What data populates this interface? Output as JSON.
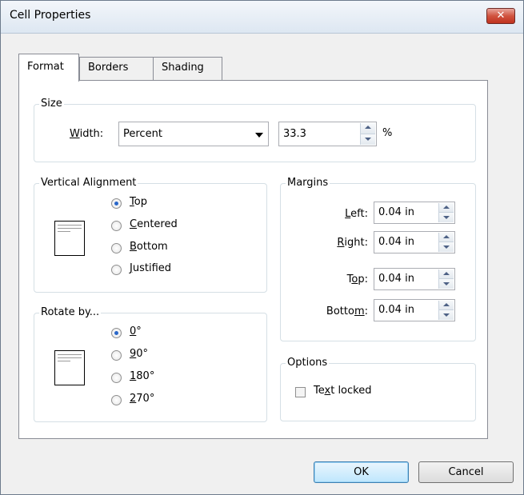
{
  "window": {
    "title": "Cell Properties",
    "close_glyph": "✕"
  },
  "tabs": [
    "Format",
    "Borders",
    "Shading"
  ],
  "size": {
    "legend": "Size",
    "width_label_prefix": "",
    "width_label_u": "W",
    "width_label_rest": "idth:",
    "type_value": "Percent",
    "amount_value": "33.3",
    "unit": "%"
  },
  "vertical_alignment": {
    "legend": "Vertical Alignment",
    "options": [
      {
        "u": "T",
        "rest": "op",
        "selected": true
      },
      {
        "u": "C",
        "rest": "entered",
        "selected": false
      },
      {
        "u": "B",
        "rest": "ottom",
        "selected": false
      },
      {
        "u": "J",
        "rest": "ustified",
        "selected": false
      }
    ]
  },
  "rotate": {
    "legend": "Rotate by...",
    "options": [
      {
        "u": "0",
        "rest": "°",
        "selected": true
      },
      {
        "u": "9",
        "rest": "0°",
        "selected": false
      },
      {
        "u": "1",
        "rest": "80°",
        "selected": false
      },
      {
        "u": "2",
        "rest": "70°",
        "selected": false
      }
    ]
  },
  "margins": {
    "legend": "Margins",
    "fields": [
      {
        "pre": "",
        "u": "L",
        "post": "eft:",
        "value": "0.04 in"
      },
      {
        "pre": "",
        "u": "R",
        "post": "ight:",
        "value": "0.04 in"
      },
      {
        "pre": "T",
        "u": "o",
        "post": "p:",
        "value": "0.04 in"
      },
      {
        "pre": "Botto",
        "u": "m",
        "post": ":",
        "value": "0.04 in"
      }
    ]
  },
  "options": {
    "legend": "Options",
    "text_locked_pre": "Te",
    "text_locked_u": "x",
    "text_locked_post": "t locked",
    "text_locked_checked": false
  },
  "buttons": {
    "ok": "OK",
    "cancel": "Cancel"
  }
}
